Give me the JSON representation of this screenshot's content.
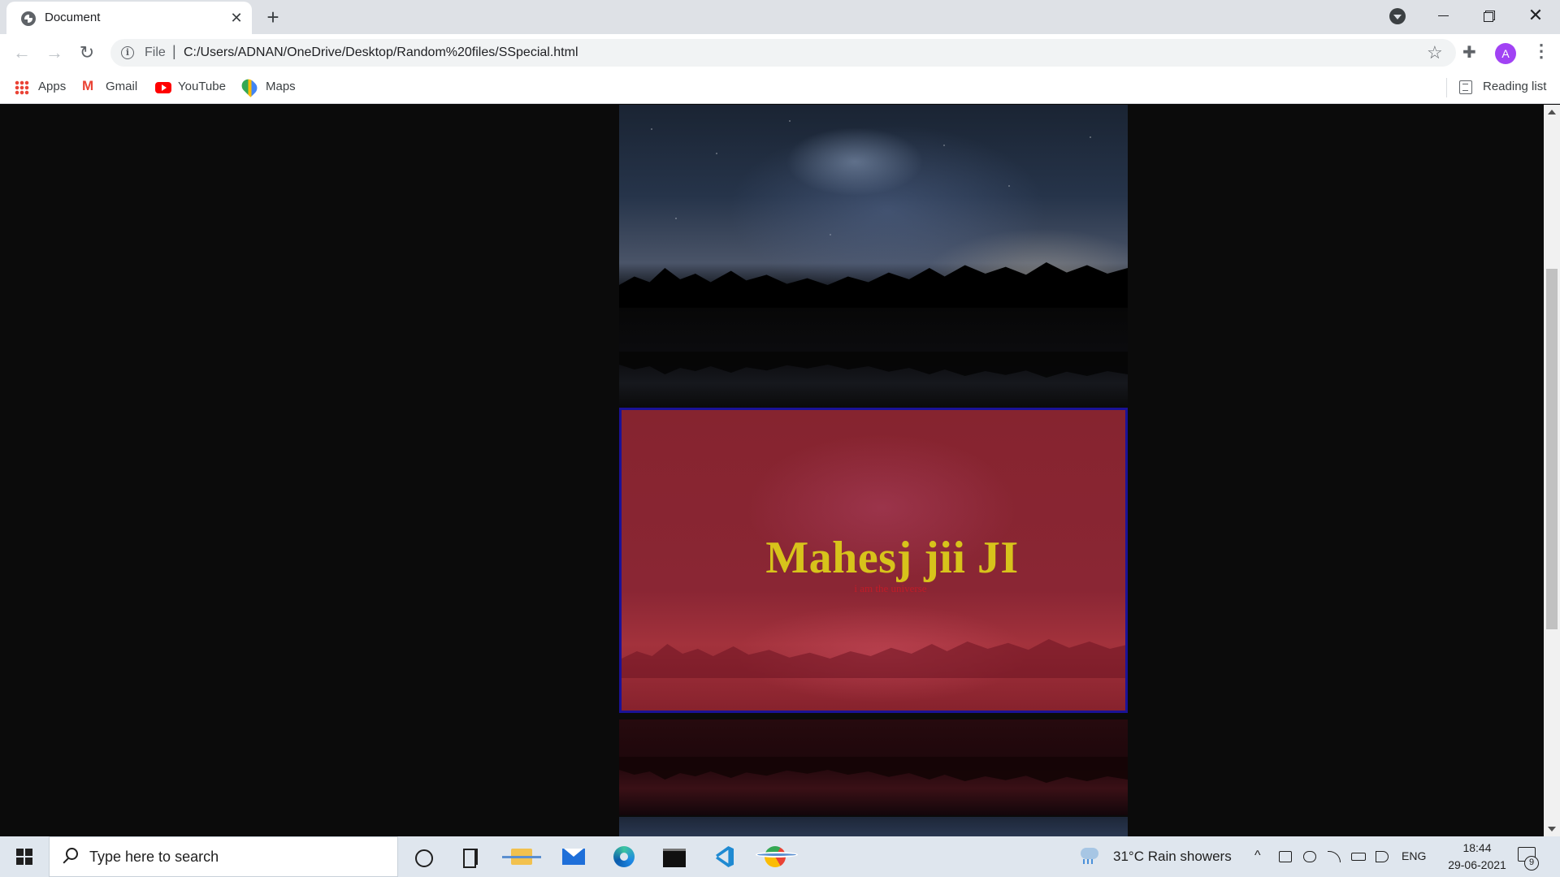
{
  "browser": {
    "tab": {
      "title": "Document",
      "close_glyph": "✕"
    },
    "new_tab_glyph": "+",
    "toolbar": {
      "back_glyph": "←",
      "forward_glyph": "→",
      "reload_glyph": "↻",
      "info_glyph": "i",
      "file_label": "File",
      "separator": "|",
      "url": "C:/Users/ADNAN/OneDrive/Desktop/Random%20files/SSpecial.html",
      "star_glyph": "☆",
      "extensions_glyph": "✚",
      "avatar_letter": "A",
      "menu_glyph": "⋮"
    },
    "bookmarks": [
      {
        "label": "Apps",
        "icon": "apps-icon"
      },
      {
        "label": "Gmail",
        "icon": "gmail-icon"
      },
      {
        "label": "YouTube",
        "icon": "youtube-icon"
      },
      {
        "label": "Maps",
        "icon": "maps-icon"
      }
    ],
    "reading_list_label": "Reading list",
    "gmail_glyph": "M",
    "window_close_glyph": "✕"
  },
  "page": {
    "hero_title": "Mahesj jii JI",
    "hero_subtitle": "i am the universe"
  },
  "taskbar": {
    "search_placeholder": "Type here to search",
    "weather": "31°C  Rain showers",
    "chevron_glyph": "^",
    "language": "ENG",
    "time": "18:44",
    "date": "29-06-2021",
    "notification_count": "9",
    "pinned": [
      "cortana-icon",
      "task-view-icon",
      "file-explorer-icon",
      "mail-icon",
      "edge-icon",
      "terminal-icon",
      "vscode-icon",
      "chrome-icon"
    ]
  },
  "colors": {
    "hero_background": "#8a2634",
    "hero_title": "#d7c31b",
    "hero_subtitle": "#c01c28",
    "hero_border": "#1b1296",
    "page_background": "#0b0b0b"
  }
}
